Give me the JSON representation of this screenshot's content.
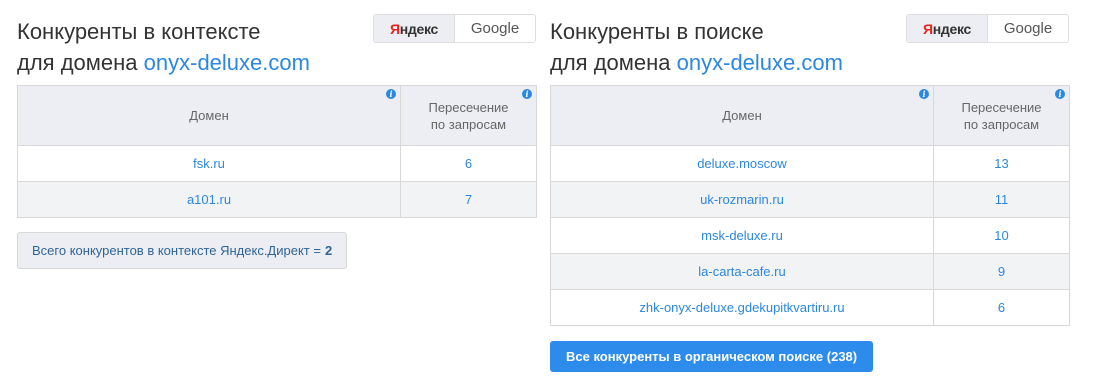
{
  "engines": {
    "yandex_first": "Я",
    "yandex_rest": "ндекс",
    "google": "Google"
  },
  "left": {
    "title_line1": "Конкуренты в контексте",
    "title_line2_prefix": "для домена ",
    "domain": "onyx-deluxe.com",
    "col_domain": "Домен",
    "col_overlap_line1": "Пересечение",
    "col_overlap_line2": "по запросам",
    "rows": [
      {
        "domain": "fsk.ru",
        "count": "6"
      },
      {
        "domain": "a101.ru",
        "count": "7"
      }
    ],
    "total_text": "Всего конкурентов в контексте Яндекс.Директ =",
    "total_value": "2"
  },
  "right": {
    "title_line1": "Конкуренты в поиске",
    "title_line2_prefix": "для домена ",
    "domain": "onyx-deluxe.com",
    "col_domain": "Домен",
    "col_overlap_line1": "Пересечение",
    "col_overlap_line2": "по запросам",
    "rows": [
      {
        "domain": "deluxe.moscow",
        "count": "13"
      },
      {
        "domain": "uk-rozmarin.ru",
        "count": "11"
      },
      {
        "domain": "msk-deluxe.ru",
        "count": "10"
      },
      {
        "domain": "la-carta-cafe.ru",
        "count": "9"
      },
      {
        "domain": "zhk-onyx-deluxe.gdekupitkvartiru.ru",
        "count": "6"
      }
    ],
    "button_label": "Все конкуренты в органическом поиске (238)"
  },
  "info_glyph": "i",
  "colors": {
    "accent": "#2c87e0",
    "button": "#2d8ceb",
    "header_bg": "#eceef3",
    "yandex_red": "#e52620"
  }
}
